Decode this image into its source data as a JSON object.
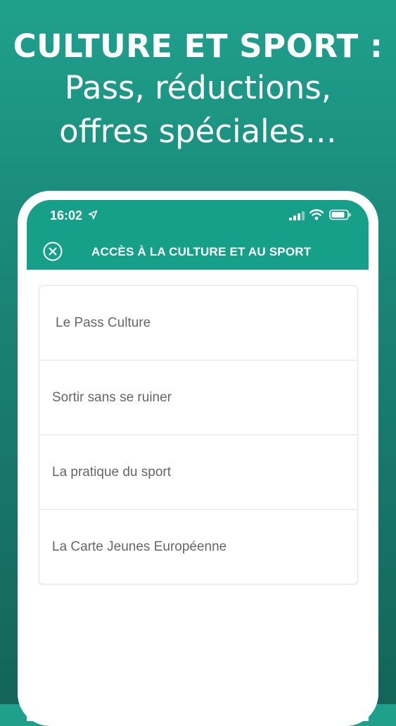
{
  "headline": {
    "line1": "CULTURE ET SPORT :",
    "line2": "Pass, réductions,",
    "line3": "offres spéciales…"
  },
  "status_bar": {
    "time": "16:02",
    "icons": [
      "location-arrow-icon",
      "signal-icon",
      "wifi-icon",
      "battery-icon"
    ]
  },
  "nav": {
    "title": "ACCÈS À LA CULTURE ET AU SPORT",
    "close_icon": "close-circle-icon"
  },
  "list": {
    "items": [
      {
        "label": "Le Pass Culture"
      },
      {
        "label": "Sortir sans se ruiner"
      },
      {
        "label": "La pratique du sport"
      },
      {
        "label": "La Carte Jeunes Européenne"
      }
    ]
  },
  "colors": {
    "accent": "#16a08a",
    "background_top": "#1fa18d",
    "background_bottom": "#146458",
    "item_text": "#666666"
  }
}
